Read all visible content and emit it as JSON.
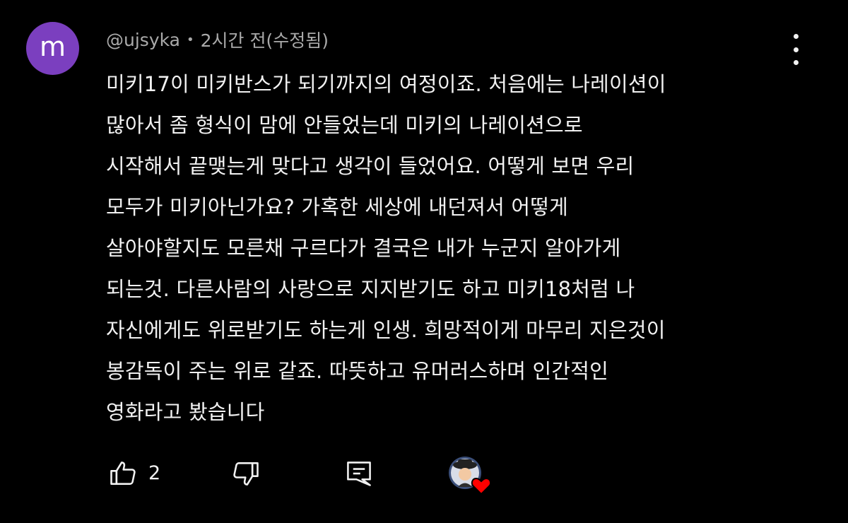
{
  "comment": {
    "avatar_letter": "m",
    "author": "@ujsyka",
    "separator": "•",
    "time": "2시간 전(수정됨)",
    "text_lines": [
      "미키17이 미키반스가 되기까지의 여정이죠. 처음에는 나레이션이",
      "많아서 좀 형식이 맘에 안들었는데  미키의 나레이션으로",
      "시작해서 끝맺는게 맞다고 생각이 들었어요. 어떻게 보면 우리",
      "모두가 미키아닌가요? 가혹한 세상에 내던져서 어떻게",
      "살아야할지도 모른채 구르다가 결국은 내가 누군지 알아가게",
      "되는것. 다른사람의 사랑으로 지지받기도 하고 미키18처럼 나",
      "자신에게도 위로받기도 하는게 인생. 희망적이게 마무리 지은것이",
      "봉감독이 주는 위로 같죠. 따뜻하고 유머러스하며 인간적인",
      "영화라고 봤습니다"
    ],
    "like_count": "2"
  },
  "icons": {
    "more": "more-vertical-icon",
    "like": "thumb-up-icon",
    "dislike": "thumb-down-icon",
    "reply": "reply-comment-icon",
    "creator_heart": "creator-heart-icon"
  },
  "colors": {
    "background": "#000000",
    "text": "#f1f1f1",
    "meta": "#aaaaaa",
    "avatar": "#7b3fbf",
    "heart": "#ff0000"
  }
}
